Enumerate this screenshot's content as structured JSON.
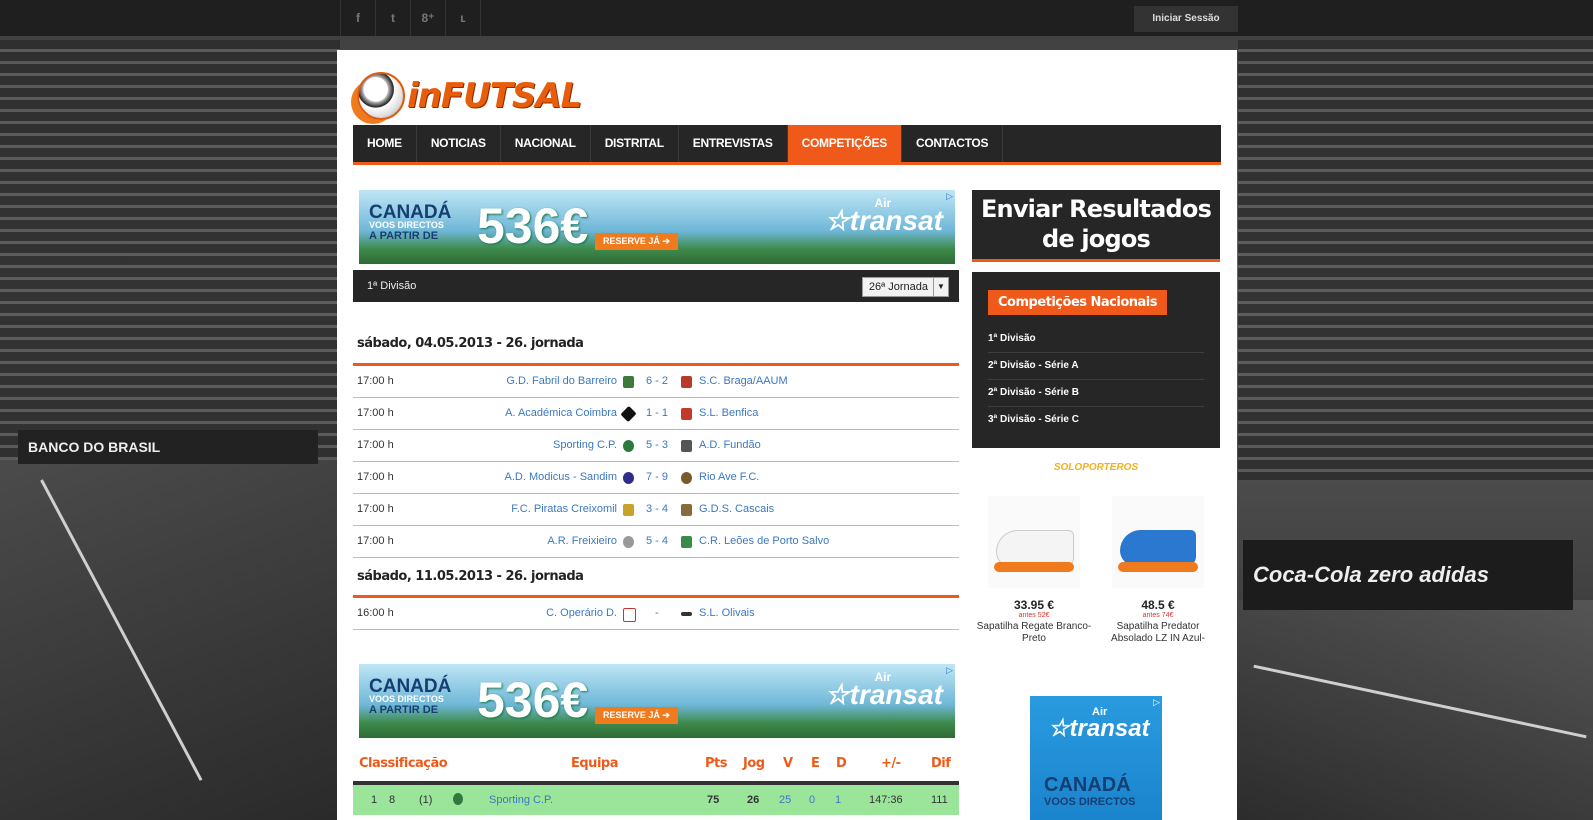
{
  "social": {
    "facebook": "f",
    "twitter": "t",
    "google": "8⁺",
    "rss": "ʟ"
  },
  "login": "Iniciar Sessão",
  "logo": "inFUTSAL",
  "nav": [
    "HOME",
    "NOTICIAS",
    "NACIONAL",
    "DISTRITAL",
    "ENTREVISTAS",
    "COMPETIÇÕES",
    "CONTACTOS"
  ],
  "ad": {
    "canada": "CANADÁ",
    "voos": "VOOS DIRECTOS",
    "apartir": "A PARTIR DE",
    "price": "536€",
    "reserve": "RESERVE JÁ ➔",
    "brand": "transat",
    "air": "Air"
  },
  "division": {
    "label": "1ª Divisão",
    "jornada": "26ª Jornada"
  },
  "days": [
    {
      "title": "sábado, 04.05.2013 - 26. jornada",
      "matches": [
        {
          "time": "17:00 h",
          "home": "G.D. Fabril do Barreiro",
          "score": "6 - 2",
          "away": "S.C. Braga/AAUM"
        },
        {
          "time": "17:00 h",
          "home": "A. Académica Coimbra",
          "score": "1 - 1",
          "away": "S.L. Benfica"
        },
        {
          "time": "17:00 h",
          "home": "Sporting C.P.",
          "score": "5 - 3",
          "away": "A.D. Fundão"
        },
        {
          "time": "17:00 h",
          "home": "A.D. Modicus - Sandim",
          "score": "7 - 9",
          "away": "Rio Ave F.C."
        },
        {
          "time": "17:00 h",
          "home": "F.C. Piratas Creixomil",
          "score": "3 - 4",
          "away": "G.D.S. Cascais"
        },
        {
          "time": "17:00 h",
          "home": "A.R. Freixieiro",
          "score": "5 - 4",
          "away": "C.R. Leões de Porto Salvo"
        }
      ]
    },
    {
      "title": "sábado, 11.05.2013 - 26. jornada",
      "matches": [
        {
          "time": "16:00 h",
          "home": "C. Operário D.",
          "score": "-",
          "away": "S.L. Olivais"
        }
      ]
    }
  ],
  "classification": {
    "headers": {
      "classificacao": "Classificação",
      "equipa": "Equipa",
      "pts": "Pts",
      "jog": "Jog",
      "v": "V",
      "e": "E",
      "d": "D",
      "gm": "+/-",
      "dif": "Dif"
    },
    "row": {
      "pos": "1",
      "prev": "8",
      "seq": "(1)",
      "team": "Sporting C.P.",
      "pts": "75",
      "jog": "26",
      "v": "25",
      "e": "0",
      "d": "1",
      "gm": "147:36",
      "dif": "111"
    }
  },
  "sidebar": {
    "send_title_1": "Enviar Resultados",
    "send_title_2": "de jogos",
    "comp_title": "Competições Nacionais",
    "comp_links": [
      "1ª Divisão",
      "2ª Divisão - Série A",
      "2ª Divisão - Série B",
      "3ª Divisão - Série C"
    ],
    "store": "SOLOPORTEROS",
    "products": [
      {
        "price": "33.95 €",
        "old": "antes 52€",
        "name": "Sapatilha Regate Branco-Preto"
      },
      {
        "price": "48.5 €",
        "old": "antes 74€",
        "name": "Sapatilha Predator Absolado LZ IN Azul-"
      }
    ],
    "side_ad": {
      "air": "Air",
      "brand": "transat",
      "canada": "CANADÁ",
      "voos": "VOOS DIRECTOS"
    }
  },
  "bg": {
    "left_banner": "BANCO DO BRASIL",
    "right_banner": "Coca-Cola zero  adidas"
  }
}
